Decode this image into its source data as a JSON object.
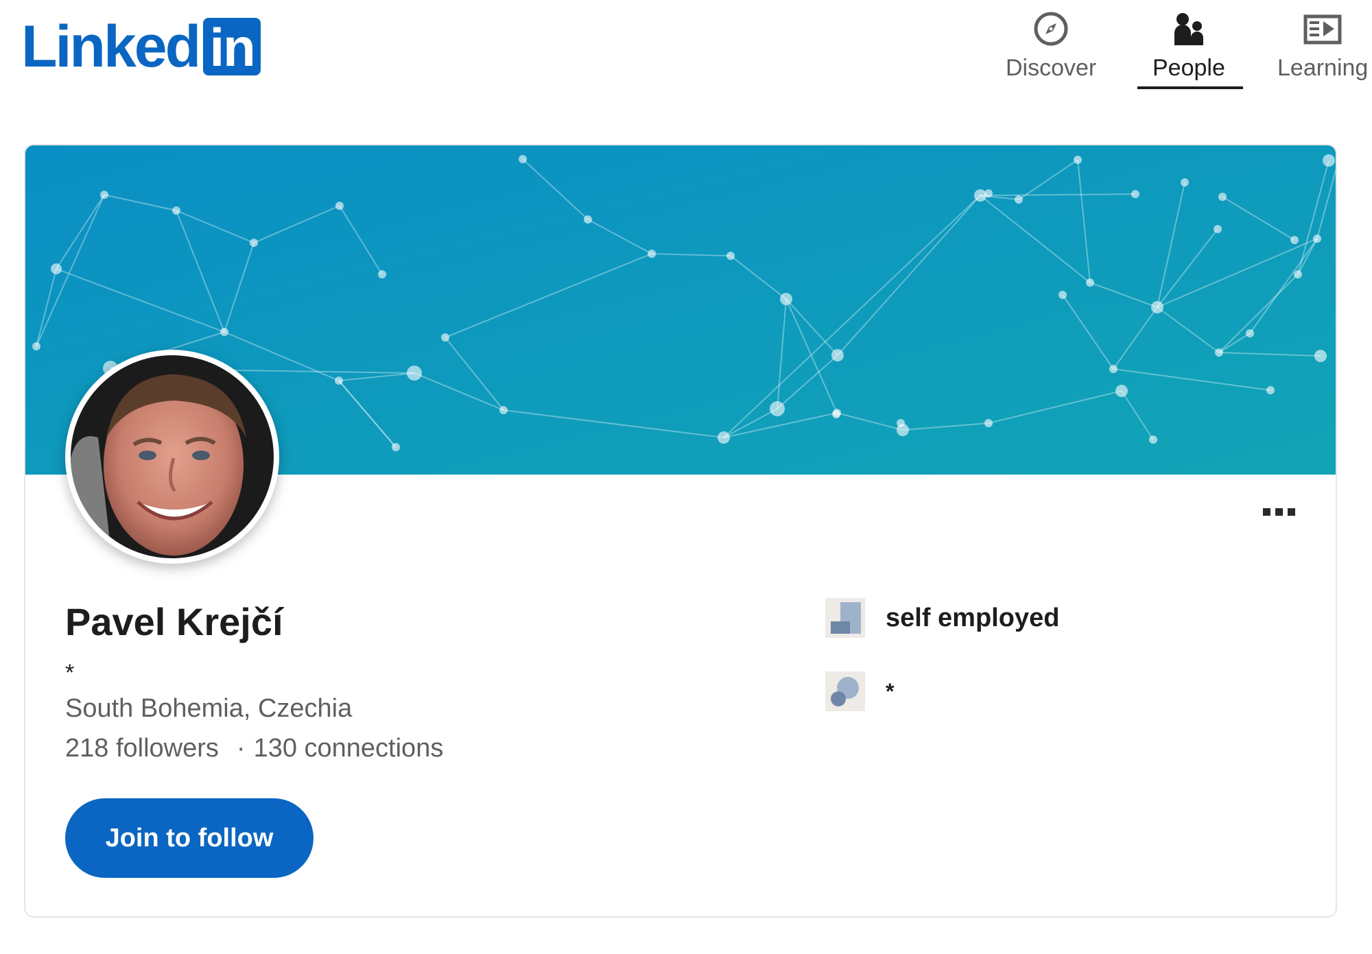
{
  "header": {
    "logo_text": "Linked",
    "logo_box_text": "in",
    "nav": [
      {
        "label": "Discover",
        "icon": "compass-icon"
      },
      {
        "label": "People",
        "icon": "people-icon",
        "active": true
      },
      {
        "label": "Learning",
        "icon": "learning-icon"
      }
    ]
  },
  "colors": {
    "brand": "#0a66c2",
    "banner_start": "#0a8fc4",
    "banner_end": "#12a4b6",
    "text_primary": "#1d1d1d",
    "text_secondary": "#5f5f5f"
  },
  "profile": {
    "name": "Pavel Krejčí",
    "headline": "*",
    "location": "South Bohemia, Czechia",
    "followers": "218 followers",
    "stats_separator": "·",
    "connections": "130 connections",
    "follow_button": "Join to follow",
    "more_icon": "more-dots-icon",
    "avatar_icon": "profile-photo",
    "current_company": {
      "name": "self employed",
      "icon": "company-logo-icon"
    },
    "education": {
      "name": "*",
      "icon": "school-logo-icon"
    }
  }
}
